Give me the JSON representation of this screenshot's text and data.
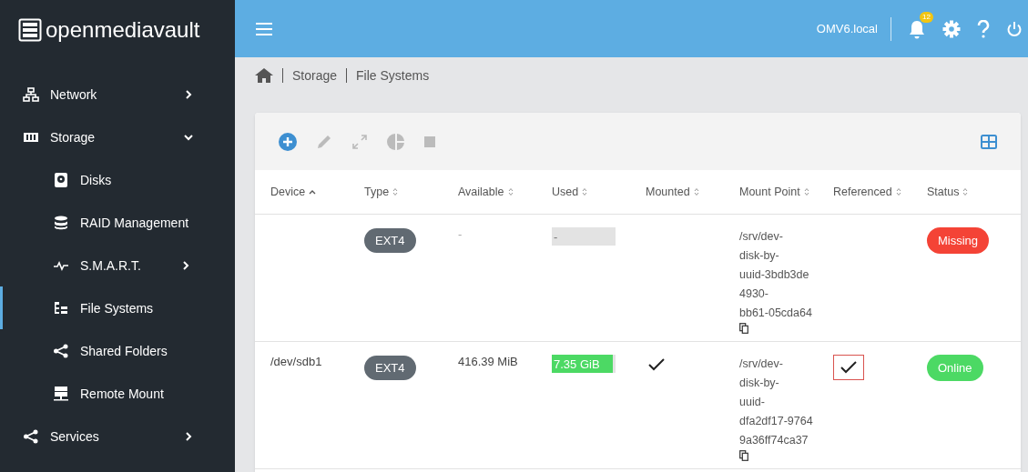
{
  "brand": "openmediavault",
  "sidebar": {
    "items": [
      {
        "label": "Network",
        "expanded": false,
        "selected": false
      },
      {
        "label": "Storage",
        "expanded": true,
        "selected": false,
        "children": [
          {
            "label": "Disks",
            "selected": false
          },
          {
            "label": "RAID Management",
            "selected": false
          },
          {
            "label": "S.M.A.R.T.",
            "expanded": false,
            "selected": false
          },
          {
            "label": "File Systems",
            "selected": true
          },
          {
            "label": "Shared Folders",
            "selected": false
          },
          {
            "label": "Remote Mount",
            "selected": false
          }
        ]
      },
      {
        "label": "Services",
        "expanded": false,
        "selected": false
      }
    ]
  },
  "topbar": {
    "hostname": "OMV6.local",
    "notification_count": "12"
  },
  "breadcrumb": [
    "Storage",
    "File Systems"
  ],
  "table": {
    "columns": [
      {
        "label": "Device",
        "sorted": true
      },
      {
        "label": "Type",
        "sorted": false
      },
      {
        "label": "Available",
        "sorted": false
      },
      {
        "label": "Used",
        "sorted": false
      },
      {
        "label": "Mounted",
        "sorted": false
      },
      {
        "label": "Mount Point",
        "sorted": false
      },
      {
        "label": "Referenced",
        "sorted": false
      },
      {
        "label": "Status",
        "sorted": false
      }
    ],
    "rows": [
      {
        "type": "EXT4",
        "available": "-",
        "used": {
          "text": "-"
        },
        "mounted": false,
        "mount_point": [
          "/srv/dev-",
          "disk-by-",
          "uuid-3bdb3de",
          "4930-",
          "bb61-05cda64"
        ],
        "referenced": false,
        "status": {
          "text": "Missing",
          "color": "#f44336"
        }
      },
      {
        "device": "/dev/sdb1",
        "type": "EXT4",
        "available": "416.39 MiB",
        "used": {
          "text": "7.35 GiB",
          "level": 0.95
        },
        "mounted": true,
        "mount_point": [
          "/srv/dev-",
          "disk-by-",
          "uuid-",
          "dfa2df17-9764",
          "9a36ff74ca37"
        ],
        "referenced": true,
        "referenced_focused": true,
        "status": {
          "text": "Online",
          "color": "#4cd964"
        }
      }
    ]
  }
}
